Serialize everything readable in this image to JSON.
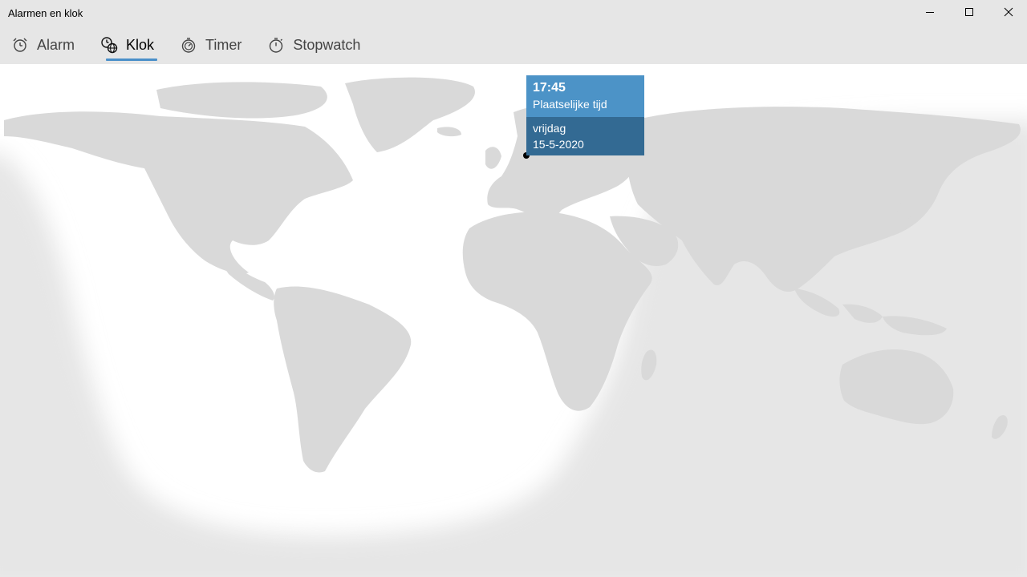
{
  "window": {
    "title": "Alarmen en klok"
  },
  "caption_buttons": {
    "minimize_icon": "minimize-icon",
    "maximize_icon": "maximize-icon",
    "close_icon": "close-icon"
  },
  "tabs": [
    {
      "label": "Alarm",
      "icon": "alarm-clock-icon",
      "active": false
    },
    {
      "label": "Klok",
      "icon": "world-clock-icon",
      "active": true
    },
    {
      "label": "Timer",
      "icon": "timer-icon",
      "active": false
    },
    {
      "label": "Stopwatch",
      "icon": "stopwatch-icon",
      "active": false
    }
  ],
  "colors": {
    "accent": "#4a8fc9",
    "tooltip_top": "#4c93c7",
    "tooltip_bottom": "#336a93",
    "land": "#d9d9d9",
    "night": "#e6e6e6",
    "day": "#ffffff"
  },
  "location_card": {
    "time": "17:45",
    "time_label": "Plaatselijke tijd",
    "weekday": "vrijdag",
    "date": "15-5-2020"
  }
}
